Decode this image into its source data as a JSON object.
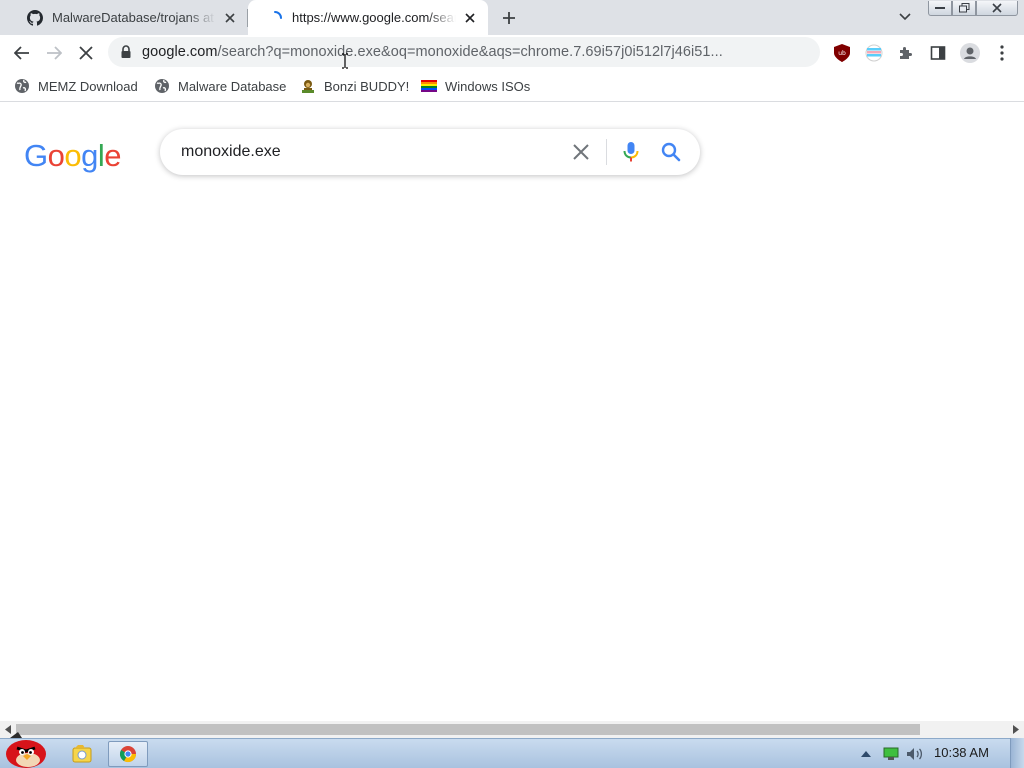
{
  "browser": {
    "tabs": [
      {
        "title": "MalwareDatabase/trojans at main",
        "icon": "github-icon",
        "active": false
      },
      {
        "title": "https://www.google.com/search",
        "icon": "loading-spinner-icon",
        "active": true
      }
    ],
    "omnibox": {
      "host": "google.com",
      "path": "/search?q=monoxide.exe&oq=monoxide&aqs=chrome.7.69i57j0i512l7j46i51..."
    },
    "bookmarks": [
      {
        "label": "MEMZ Download",
        "icon": "globe-icon"
      },
      {
        "label": "Malware Database",
        "icon": "globe-icon"
      },
      {
        "label": "Bonzi BUDDY!",
        "icon": "bonzi-icon"
      },
      {
        "label": "Windows ISOs",
        "icon": "rainbow-flag-icon"
      }
    ],
    "extensions": [
      "ublock-icon",
      "pride-extension-icon",
      "puzzle-icon",
      "side-panel-icon",
      "profile-icon",
      "menu-icon"
    ]
  },
  "page": {
    "logo": "Google",
    "search_query": "monoxide.exe",
    "colors": {
      "blue": "#4285f4",
      "red": "#ea4335",
      "yellow": "#fbbc05",
      "green": "#34a853"
    }
  },
  "taskbar": {
    "clock": "10:38 AM",
    "items": [
      "start-orb-angry-bird-icon",
      "explorer-icon",
      "chrome-icon"
    ],
    "tray": [
      "show-hidden-icons",
      "network-icon",
      "volume-icon"
    ]
  }
}
